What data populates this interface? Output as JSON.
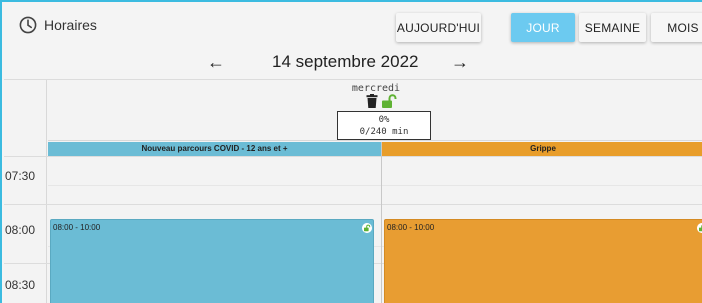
{
  "header": {
    "title": "Horaires",
    "clock_icon": "clock-icon",
    "buttons": {
      "today": "AUJOURD'HUI",
      "day": "JOUR",
      "week": "SEMAINE",
      "month": "MOIS"
    },
    "active_view": "JOUR"
  },
  "nav": {
    "prev_icon": "←",
    "next_icon": "→",
    "date": "14 septembre 2022"
  },
  "day": {
    "name": "mercredi",
    "icons": [
      "trash-icon",
      "unlock-icon"
    ],
    "capacity_percent": "0%",
    "capacity_minutes": "0/240 min"
  },
  "resources": [
    {
      "name": "Nouveau parcours COVID - 12 ans et +",
      "color": "#6bbcd5"
    },
    {
      "name": "Grippe",
      "color": "#e89d2a"
    }
  ],
  "time_slots": [
    "07:30",
    "08:00",
    "08:30"
  ],
  "events": [
    {
      "time": "08:00 - 10:00",
      "resource": 0,
      "icon": "unlock-icon"
    },
    {
      "time": "08:00 - 10:00",
      "resource": 1,
      "icon": "unlock-icon"
    }
  ],
  "colors": {
    "accent": "#3bbbe0",
    "active_button": "#6ccaf0",
    "lock_green": "#5fb233"
  }
}
